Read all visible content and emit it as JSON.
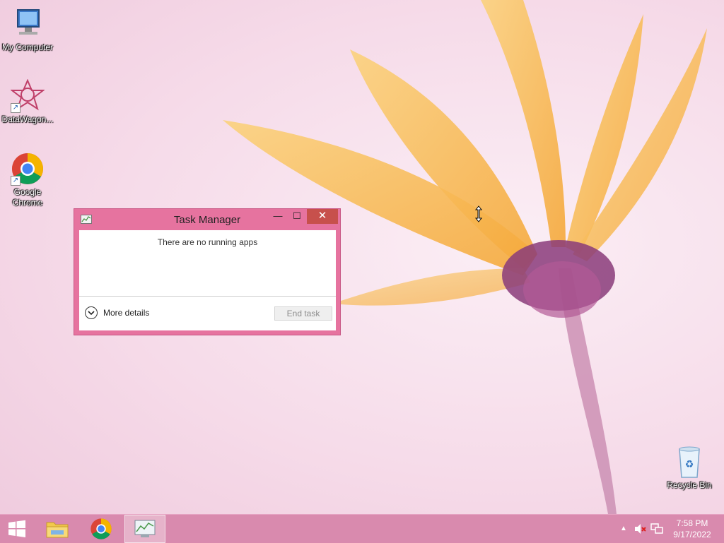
{
  "desktop": {
    "icons": [
      {
        "label": "My Computer",
        "icon": "computer-icon"
      },
      {
        "label": "DataWagon...",
        "icon": "datawagon-icon"
      },
      {
        "label": "Google Chrome",
        "icon": "chrome-icon"
      },
      {
        "label": "Recycle Bin",
        "icon": "recycle-bin-icon"
      }
    ]
  },
  "task_manager": {
    "title": "Task Manager",
    "empty_message": "There are no running apps",
    "more_details_label": "More details",
    "end_task_label": "End task",
    "minimize_glyph": "—",
    "maximize_glyph": "☐",
    "close_glyph": "✕"
  },
  "taskbar": {
    "items": [
      "start-button",
      "file-explorer",
      "google-chrome",
      "task-manager"
    ],
    "active_item": "task-manager",
    "clock_time": "7:58 PM",
    "clock_date": "9/17/2022",
    "tray_icons": [
      "show-hidden-icons",
      "volume-muted-icon",
      "network-icon"
    ]
  },
  "colors": {
    "window_frame": "#e6739f",
    "close_button": "#c7504c",
    "taskbar": "#d98aae"
  }
}
